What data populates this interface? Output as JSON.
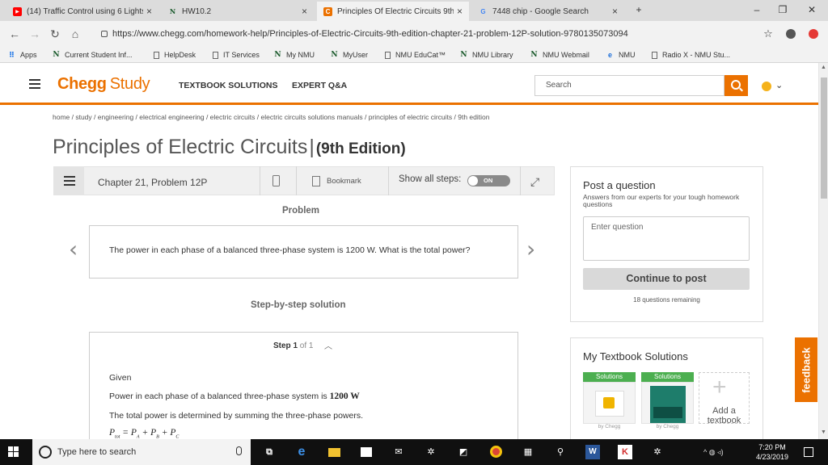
{
  "browser": {
    "tabs": [
      {
        "label": "(14) Traffic Control using 6 Lights",
        "icon": "youtube-icon",
        "active": false
      },
      {
        "label": "HW10.2",
        "icon": "nmu-icon",
        "active": false
      },
      {
        "label": "Principles Of Electric Circuits 9th",
        "icon": "chegg-icon",
        "active": true
      },
      {
        "label": "7448 chip - Google Search",
        "icon": "google-icon",
        "active": false
      }
    ],
    "new_tab": "+",
    "url": "https://www.chegg.com/homework-help/Principles-of-Electric-Circuits-9th-edition-chapter-21-problem-12P-solution-9780135073094",
    "bookmarks": [
      {
        "label": "Apps",
        "icon": "apps-icon"
      },
      {
        "label": "Current Student Inf...",
        "icon": "nmu-icon"
      },
      {
        "label": "HelpDesk",
        "icon": "page-icon"
      },
      {
        "label": "IT Services",
        "icon": "page-icon"
      },
      {
        "label": "My NMU",
        "icon": "nmu-icon"
      },
      {
        "label": "MyUser",
        "icon": "nmu-icon"
      },
      {
        "label": "NMU EduCat™",
        "icon": "page-icon"
      },
      {
        "label": "NMU Library",
        "icon": "nmu-icon"
      },
      {
        "label": "NMU Webmail",
        "icon": "nmu-icon"
      },
      {
        "label": "NMU",
        "icon": "edge-icon"
      },
      {
        "label": "Radio X - NMU Stu...",
        "icon": "page-icon"
      }
    ]
  },
  "header": {
    "logo_brand": "Chegg",
    "logo_product": "Study",
    "nav": [
      "TEXTBOOK SOLUTIONS",
      "EXPERT Q&A"
    ],
    "search_placeholder": "Search"
  },
  "breadcrumb": "home / study / engineering / electrical engineering / electric circuits / electric circuits solutions manuals / principles of electric circuits / 9th edition",
  "book": {
    "title": "Principles of Electric Circuits",
    "edition": "(9th Edition)"
  },
  "problem_toolbar": {
    "chapter": "Chapter 21, Problem 12P",
    "bookmark": "Bookmark",
    "show_steps": "Show all steps:",
    "toggle_state": "ON"
  },
  "problem": {
    "heading": "Problem",
    "text": "The power in each phase of a balanced three-phase system is 1200 W. What is the total power?"
  },
  "solution": {
    "heading": "Step-by-step solution",
    "step_word": "Step",
    "step_current": "1",
    "step_of": "of 1",
    "given": "Given",
    "line1": "Power in each phase of a balanced three-phase system is",
    "line1_value": "1200 W",
    "line2": "The total power is determined by summing the three-phase powers.",
    "equation": "Ptot = PA + PB + PC"
  },
  "post_question": {
    "title": "Post a question",
    "subtitle": "Answers from our experts for your tough homework questions",
    "placeholder": "Enter question",
    "button": "Continue to post",
    "remaining": "18 questions remaining"
  },
  "textbook_solutions": {
    "title": "My Textbook Solutions",
    "badge": "Solutions",
    "by": "by Chegg",
    "add": "Add a textbook"
  },
  "feedback": "feedback",
  "taskbar": {
    "search_placeholder": "Type here to search",
    "time": "7:20 PM",
    "date": "4/23/2019"
  },
  "colors": {
    "brand": "#eb7100",
    "solutions_badge": "#4caf50"
  }
}
